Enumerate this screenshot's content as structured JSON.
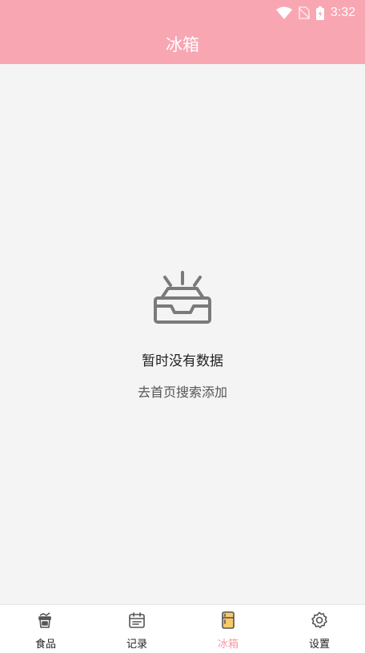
{
  "status_bar": {
    "time": "3:32"
  },
  "header": {
    "title": "冰箱"
  },
  "empty_state": {
    "title": "暂时没有数据",
    "hint": "去首页搜索添加"
  },
  "tabbar": {
    "tabs": [
      {
        "label": "食品",
        "icon": "food-jar-icon",
        "active": false
      },
      {
        "label": "记录",
        "icon": "calendar-icon",
        "active": false
      },
      {
        "label": "冰箱",
        "icon": "fridge-icon",
        "active": true
      },
      {
        "label": "设置",
        "icon": "gear-icon",
        "active": false
      }
    ]
  },
  "colors": {
    "header_bg": "#f9a6b3",
    "active_tab": "#f59aa8",
    "content_bg": "#f4f4f4"
  }
}
